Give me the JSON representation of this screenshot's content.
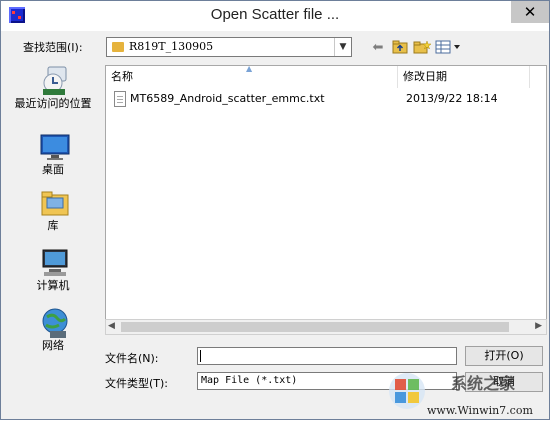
{
  "window": {
    "title": "Open Scatter file ...",
    "close_glyph": "✕"
  },
  "toolbar": {
    "look_in_label": "查找范围(I):",
    "look_in_value": "R819T_130905",
    "icons": [
      "back-arrow-icon",
      "up-folder-icon",
      "new-folder-icon",
      "view-menu-icon"
    ]
  },
  "places": [
    {
      "label": "最近访问的位置",
      "icon": "recent-places-icon"
    },
    {
      "label": "桌面",
      "icon": "desktop-icon"
    },
    {
      "label": "库",
      "icon": "libraries-icon"
    },
    {
      "label": "计算机",
      "icon": "computer-icon"
    },
    {
      "label": "网络",
      "icon": "network-icon"
    }
  ],
  "filelist": {
    "columns": [
      "名称",
      "修改日期"
    ],
    "rows": [
      {
        "name": "MT6589_Android_scatter_emmc.txt",
        "modified": "2013/9/22 18:14"
      }
    ]
  },
  "filename": {
    "label": "文件名(N):",
    "value": ""
  },
  "filetype": {
    "label": "文件类型(T):",
    "value": "Map File (*.txt)"
  },
  "buttons": {
    "open": "打开(O)",
    "cancel": "取消"
  },
  "watermark": {
    "text_cn": "系统之家",
    "url": "www.Winwin7.com"
  }
}
